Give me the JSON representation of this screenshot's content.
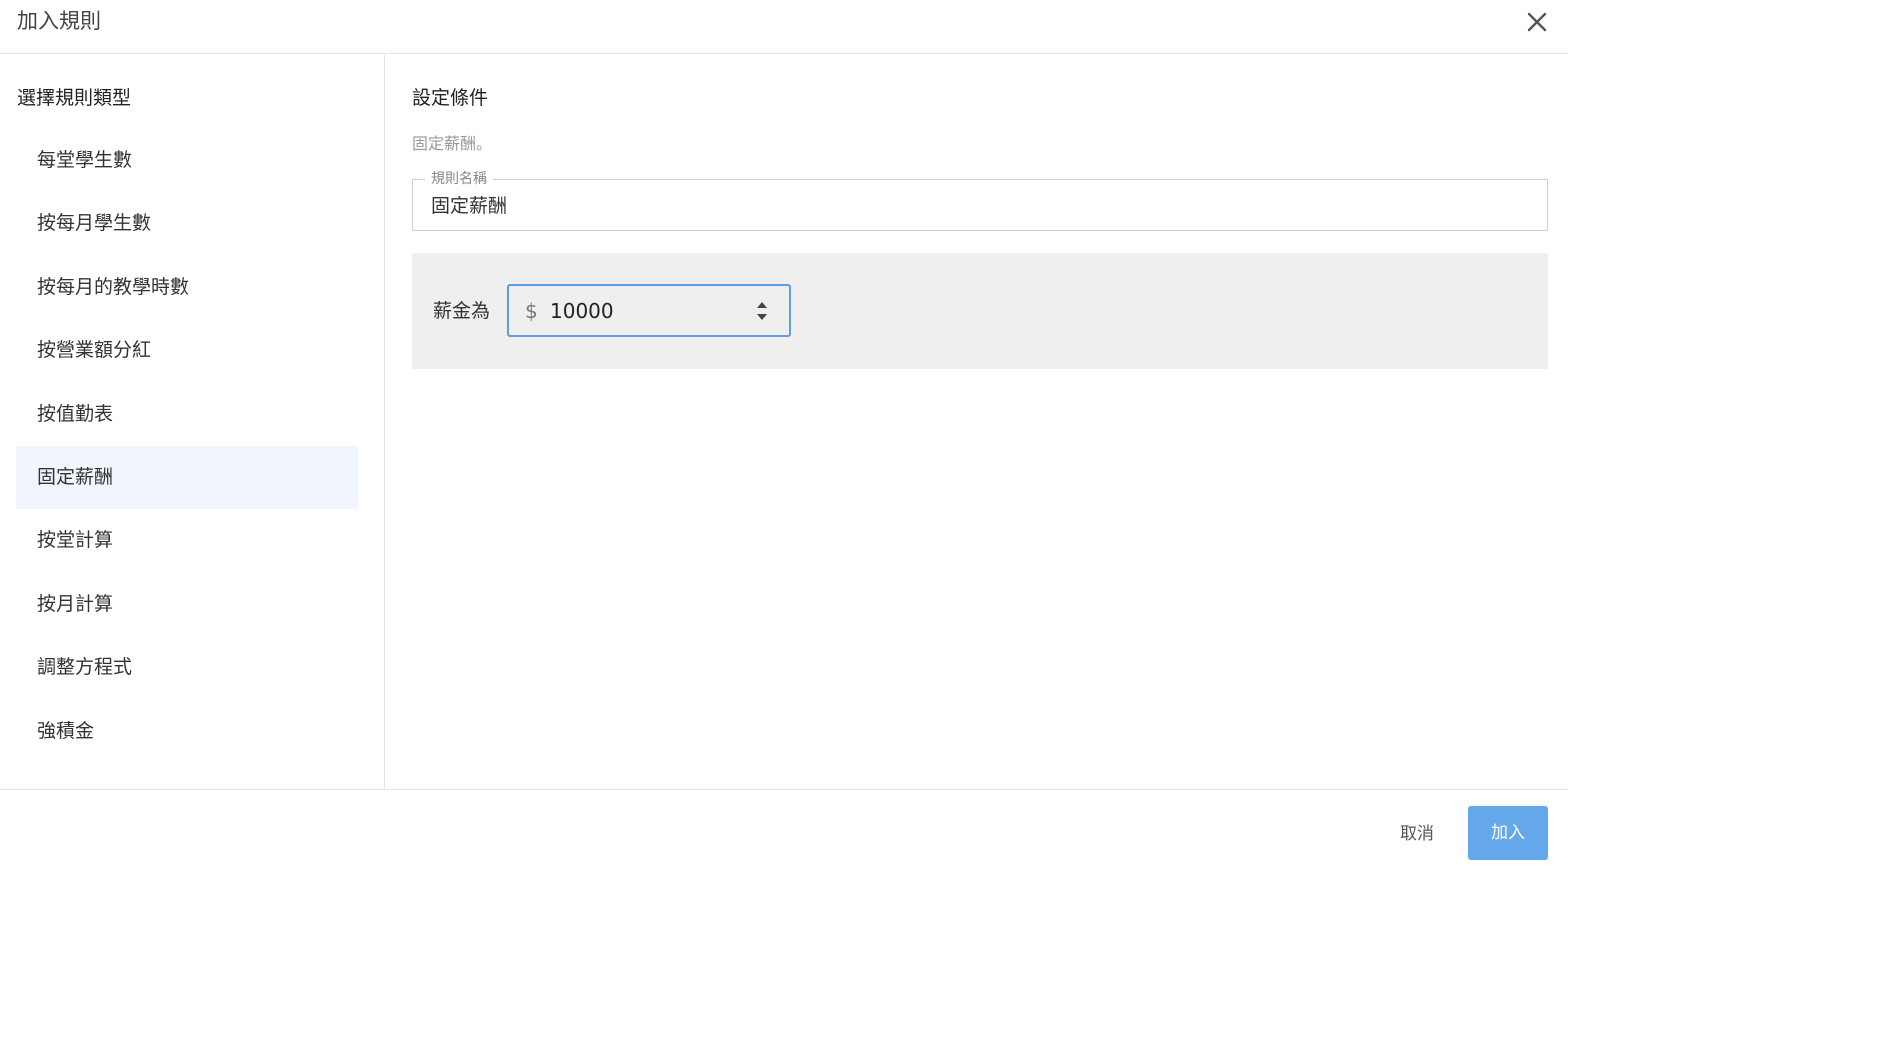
{
  "dialog": {
    "title": "加入規則",
    "close_icon": "close-icon"
  },
  "rule_types": {
    "heading": "選擇規則類型",
    "selected_index": 5,
    "items": [
      {
        "label": "每堂學生數"
      },
      {
        "label": "按每月學生數"
      },
      {
        "label": "按每月的教學時數"
      },
      {
        "label": "按營業額分紅"
      },
      {
        "label": "按值勤表"
      },
      {
        "label": "固定薪酬"
      },
      {
        "label": "按堂計算"
      },
      {
        "label": "按月計算"
      },
      {
        "label": "調整方程式"
      },
      {
        "label": "強積金"
      }
    ]
  },
  "conditions": {
    "heading": "設定條件",
    "description": "固定薪酬。",
    "rule_name": {
      "label": "規則名稱",
      "value": "固定薪酬"
    },
    "salary": {
      "label": "薪金為",
      "currency_symbol": "$",
      "value": "10000",
      "stepper_icon": "stepper-arrows-icon"
    }
  },
  "footer": {
    "cancel_label": "取消",
    "add_label": "加入"
  },
  "colors": {
    "accent": "#64a8eb",
    "focus_border": "#5b9ee6",
    "selected_bg": "#f1f6fe",
    "condition_bg": "#efefef"
  }
}
